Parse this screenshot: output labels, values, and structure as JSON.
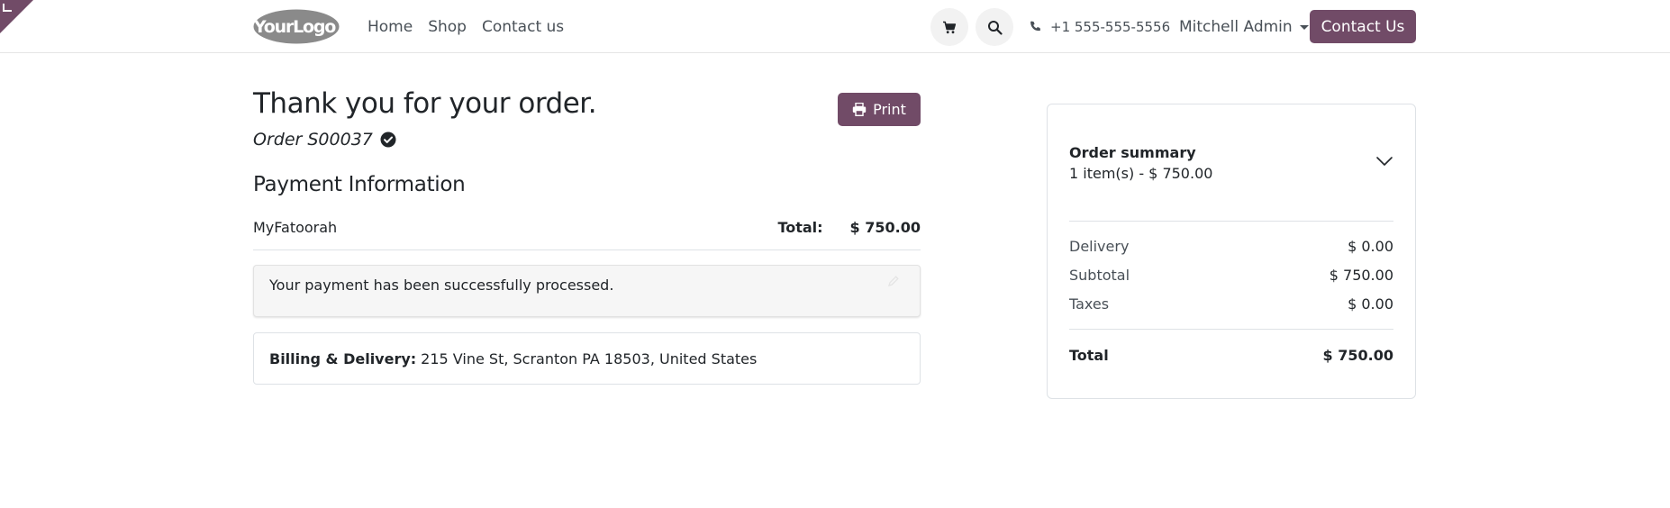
{
  "header": {
    "logo_text": "YourLogo",
    "nav": [
      "Home",
      "Shop",
      "Contact us"
    ],
    "phone": "+1 555-555-5556",
    "user": "Mitchell Admin",
    "contact_label": "Contact Us",
    "icons": {
      "cart": "cart-icon",
      "search": "search-icon",
      "phone": "phone-icon",
      "caret": "caret-down-icon"
    }
  },
  "main": {
    "title": "Thank you for your order.",
    "order_ref": "Order S00037",
    "print_label": "Print",
    "payment": {
      "heading": "Payment Information",
      "method": "MyFatoorah",
      "total_label": "Total:",
      "total_value": "$ 750.00"
    },
    "alert_message": "Your payment has been successfully processed.",
    "address": {
      "label": "Billing & Delivery:",
      "value": "215 Vine St, Scranton PA 18503, United States"
    }
  },
  "summary": {
    "title": "Order summary",
    "subtitle": "1 item(s) -  $ 750.00",
    "lines": [
      {
        "label": "Delivery",
        "value": "$ 0.00"
      },
      {
        "label": "Subtotal",
        "value": "$ 750.00"
      },
      {
        "label": "Taxes",
        "value": "$ 0.00"
      }
    ],
    "total_label": "Total",
    "total_value": "$ 750.00"
  },
  "colors": {
    "brand": "#714b67",
    "text": "#212529",
    "muted": "#495057",
    "border": "#dee2e6"
  }
}
